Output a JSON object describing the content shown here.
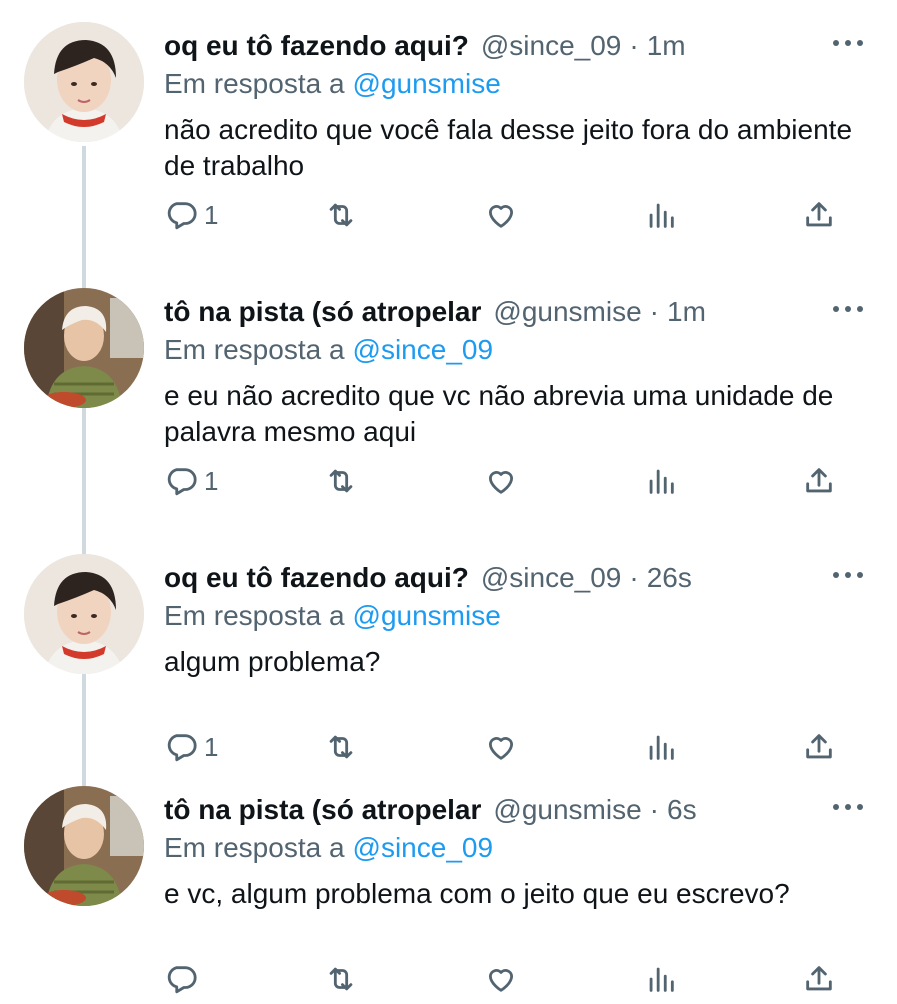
{
  "tweets": [
    {
      "display_name": "oq eu tô fazendo aqui?",
      "handle": "@since_09",
      "time": "1m",
      "reply_prefix": "Em resposta a",
      "reply_handle": "@gunsmise",
      "text": "não acredito que você fala desse jeito fora do ambiente de trabalho",
      "reply_count": "1",
      "avatar": "avatar-a"
    },
    {
      "display_name": "tô na pista (só atropelar",
      "handle": "@gunsmise",
      "time": "1m",
      "reply_prefix": "Em resposta a",
      "reply_handle": "@since_09",
      "text": "e eu não acredito que vc não abrevia uma unidade de palavra mesmo aqui",
      "reply_count": "1",
      "avatar": "avatar-b"
    },
    {
      "display_name": "oq eu tô fazendo aqui?",
      "handle": "@since_09",
      "time": "26s",
      "reply_prefix": "Em resposta a",
      "reply_handle": "@gunsmise",
      "text": "algum problema?",
      "reply_count": "1",
      "avatar": "avatar-a"
    },
    {
      "display_name": "tô na pista (só atropelar",
      "handle": "@gunsmise",
      "time": "6s",
      "reply_prefix": "Em resposta a",
      "reply_handle": "@since_09",
      "text": "e vc, algum problema com o jeito que eu escrevo?",
      "reply_count": "",
      "avatar": "avatar-b"
    }
  ],
  "separator": "·",
  "icons": {
    "reply": "reply-icon",
    "retweet": "retweet-icon",
    "like": "heart-icon",
    "views": "views-icon",
    "share": "share-icon",
    "more": "more-icon"
  },
  "colors": {
    "accent": "#1d9bf0",
    "secondary_text": "#536471",
    "thread_line": "#cfd9de"
  }
}
